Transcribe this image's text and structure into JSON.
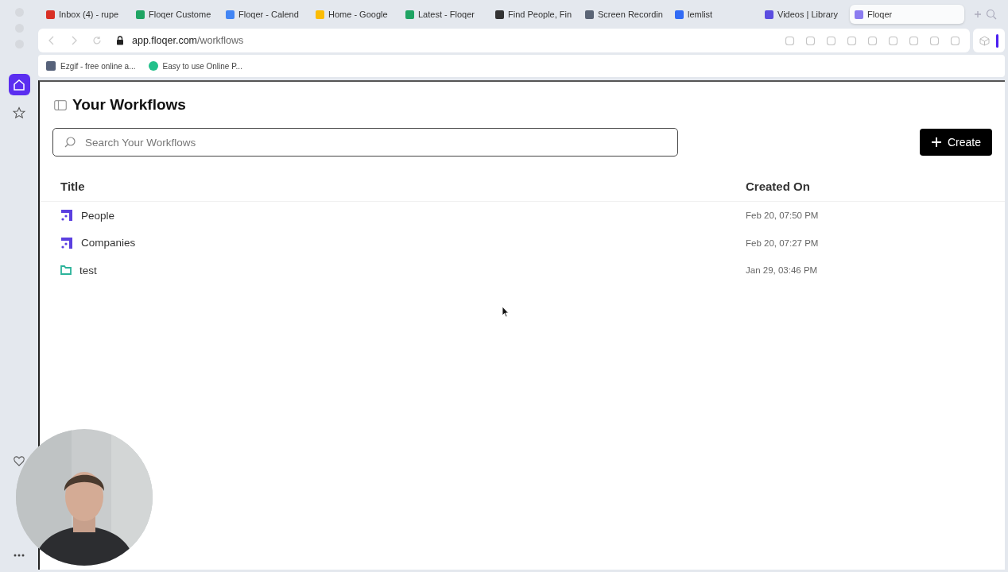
{
  "tabs": [
    {
      "label": "Inbox (4) - rupe",
      "selected": false
    },
    {
      "label": "Floqer Custome",
      "selected": false
    },
    {
      "label": "Floqer - Calend",
      "selected": false
    },
    {
      "label": "Home - Google",
      "selected": false
    },
    {
      "label": "Latest - Floqer",
      "selected": false
    },
    {
      "label": "Find People, Fin",
      "selected": false
    },
    {
      "label": "Screen Recordin",
      "selected": false
    },
    {
      "label": "lemlist",
      "selected": false
    },
    {
      "label": "Videos | Library",
      "selected": false
    },
    {
      "label": "Floqer",
      "selected": true
    }
  ],
  "address_bar": {
    "host": "app.floqer.com",
    "path": "/workflows"
  },
  "bookmarks": [
    "Ezgif - free online a...",
    "Easy to use Online P..."
  ],
  "page": {
    "title": "Your Workflows",
    "search": {
      "placeholder": "Search Your Workflows"
    },
    "create_button": "Create",
    "table": {
      "columns": [
        "Title",
        "Created On"
      ],
      "rows": [
        {
          "kind": "workflow",
          "title": "People",
          "created_on": "Feb 20, 07:50 PM"
        },
        {
          "kind": "workflow",
          "title": "Companies",
          "created_on": "Feb 20, 07:27 PM"
        },
        {
          "kind": "folder",
          "title": "test",
          "created_on": "Jan 29, 03:46 PM"
        }
      ]
    }
  },
  "webcam": {
    "kind": "picture"
  }
}
